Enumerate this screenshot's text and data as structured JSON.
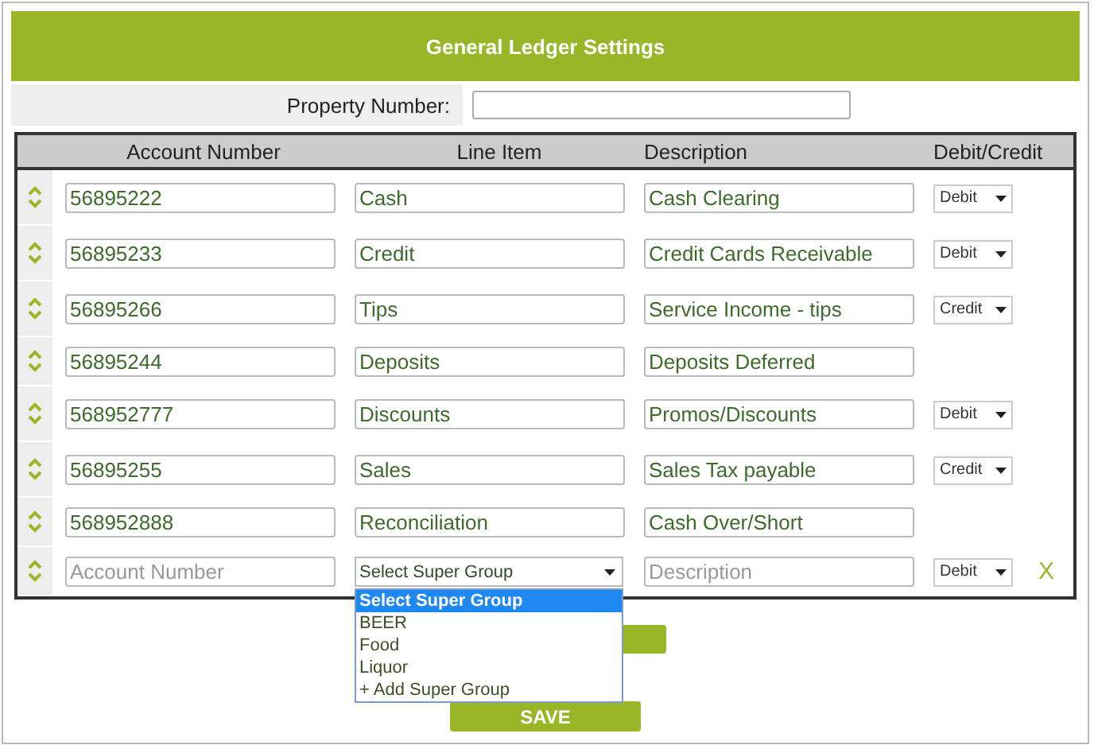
{
  "title": "General Ledger Settings",
  "property": {
    "label": "Property Number:"
  },
  "columns": [
    "Account Number",
    "Line Item",
    "Description",
    "Debit/Credit"
  ],
  "rows": [
    {
      "account": "56895222",
      "line_item": "Cash",
      "description": "Cash Clearing",
      "debit_credit": "Debit"
    },
    {
      "account": "56895233",
      "line_item": "Credit",
      "description": "Credit Cards Receivable",
      "debit_credit": "Debit"
    },
    {
      "account": "56895266",
      "line_item": "Tips",
      "description": "Service Income - tips",
      "debit_credit": "Credit"
    },
    {
      "account": "56895244",
      "line_item": "Deposits",
      "description": "Deposits Deferred"
    },
    {
      "account": "568952777",
      "line_item": "Discounts",
      "description": "Promos/Discounts",
      "debit_credit": "Debit"
    },
    {
      "account": "56895255",
      "line_item": "Sales",
      "description": "Sales Tax payable",
      "debit_credit": "Credit"
    },
    {
      "account": "568952888",
      "line_item": "Reconciliation",
      "description": "Cash Over/Short"
    }
  ],
  "new_row": {
    "account_placeholder": "Account Number",
    "super_group": "Select Super Group",
    "description_placeholder": "Description",
    "debit_credit": "Debit",
    "remove": "X",
    "options": [
      {
        "label": "Select Super Group",
        "selected": true
      },
      {
        "label": "BEER",
        "selected": false
      },
      {
        "label": "Food",
        "selected": false
      },
      {
        "label": "Liquor",
        "selected": false
      },
      {
        "label": "+ Add Super Group",
        "selected": false
      }
    ]
  },
  "save_button": "SAVE"
}
